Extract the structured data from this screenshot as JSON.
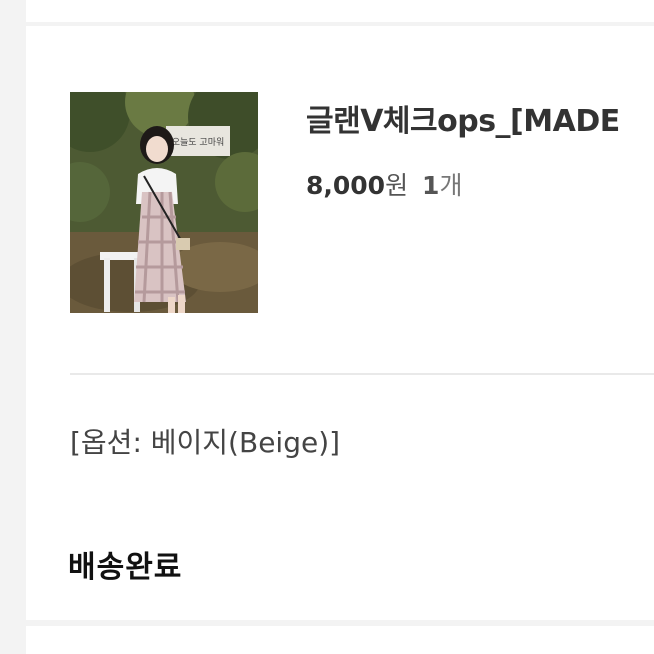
{
  "order_item": {
    "product_name": "글랜V체크ops_[MADE",
    "thumbnail": {
      "banner_text": "오늘도 고마워"
    },
    "price": {
      "amount": "8,000",
      "currency_unit": "원",
      "quantity": "1",
      "quantity_unit": "개"
    },
    "option_text": "[옵션: 베이지(Beige)]",
    "status": "배송완료"
  }
}
